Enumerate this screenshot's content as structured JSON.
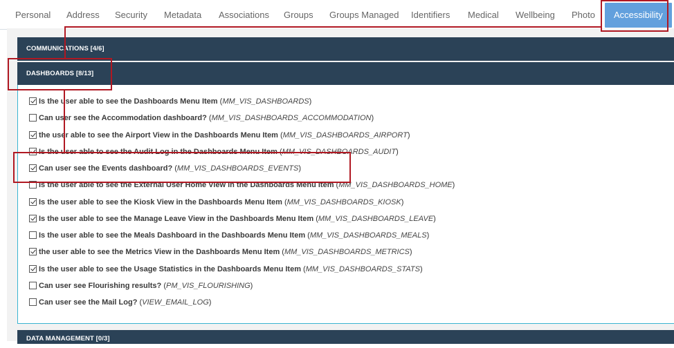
{
  "tabs": [
    {
      "label": "Personal",
      "active": false
    },
    {
      "label": "Address",
      "active": false
    },
    {
      "label": "Security",
      "active": false
    },
    {
      "label": "Metadata",
      "active": false
    },
    {
      "label": "Associations",
      "active": false
    },
    {
      "label": "Groups",
      "active": false
    },
    {
      "label": "Groups Managed",
      "active": false
    },
    {
      "label": "Identifiers",
      "active": false
    },
    {
      "label": "Medical",
      "active": false
    },
    {
      "label": "Wellbeing",
      "active": false
    },
    {
      "label": "Photo",
      "active": false
    },
    {
      "label": "Accessibility",
      "active": true
    }
  ],
  "sections": {
    "communications": {
      "title": "COMMUNICATIONS [4/6]"
    },
    "dashboards": {
      "title": "DASHBOARDS [8/13]"
    },
    "data_management": {
      "title": "DATA MANAGEMENT [0/3]"
    }
  },
  "items": [
    {
      "checked": true,
      "label": "Is the user able to see the Dashboards Menu Item",
      "code": "MM_VIS_DASHBOARDS"
    },
    {
      "checked": false,
      "label": "Can user see the Accommodation dashboard?",
      "code": "MM_VIS_DASHBOARDS_ACCOMMODATION"
    },
    {
      "checked": true,
      "label": "the user able to see the Airport View in the Dashboards Menu Item",
      "code": "MM_VIS_DASHBOARDS_AIRPORT"
    },
    {
      "checked": true,
      "label": "Is the user able to see the Audit Log in the Dashboards Menu Item",
      "code": "MM_VIS_DASHBOARDS_AUDIT"
    },
    {
      "checked": true,
      "label": "Can user see the Events dashboard?",
      "code": "MM_VIS_DASHBOARDS_EVENTS"
    },
    {
      "checked": false,
      "label": "Is the user able to see the External User Home View in the Dashboards Menu Item",
      "code": "MM_VIS_DASHBOARDS_HOME"
    },
    {
      "checked": true,
      "label": "Is the user able to see the Kiosk View in the Dashboards Menu Item",
      "code": "MM_VIS_DASHBOARDS_KIOSK"
    },
    {
      "checked": true,
      "label": "Is the user able to see the Manage Leave View in the Dashboards Menu Item",
      "code": "MM_VIS_DASHBOARDS_LEAVE"
    },
    {
      "checked": false,
      "label": "Is the user able to see the Meals Dashboard in the Dashboards Menu Item",
      "code": "MM_VIS_DASHBOARDS_MEALS"
    },
    {
      "checked": true,
      "label": "the user able to see the Metrics View in the Dashboards Menu Item",
      "code": "MM_VIS_DASHBOARDS_METRICS"
    },
    {
      "checked": true,
      "label": "Is the user able to see the Usage Statistics in the Dashboards Menu Item",
      "code": "MM_VIS_DASHBOARDS_STATS"
    },
    {
      "checked": false,
      "label": "Can user see Flourishing results?",
      "code": "PM_VIS_FLOURISHING"
    },
    {
      "checked": false,
      "label": "Can user see the Mail Log?",
      "code": "VIEW_EMAIL_LOG"
    }
  ],
  "colors": {
    "header_bg": "#2b4257",
    "active_tab": "#62a0dd",
    "accent_border": "#39b4d1",
    "annotation": "#b01822"
  }
}
